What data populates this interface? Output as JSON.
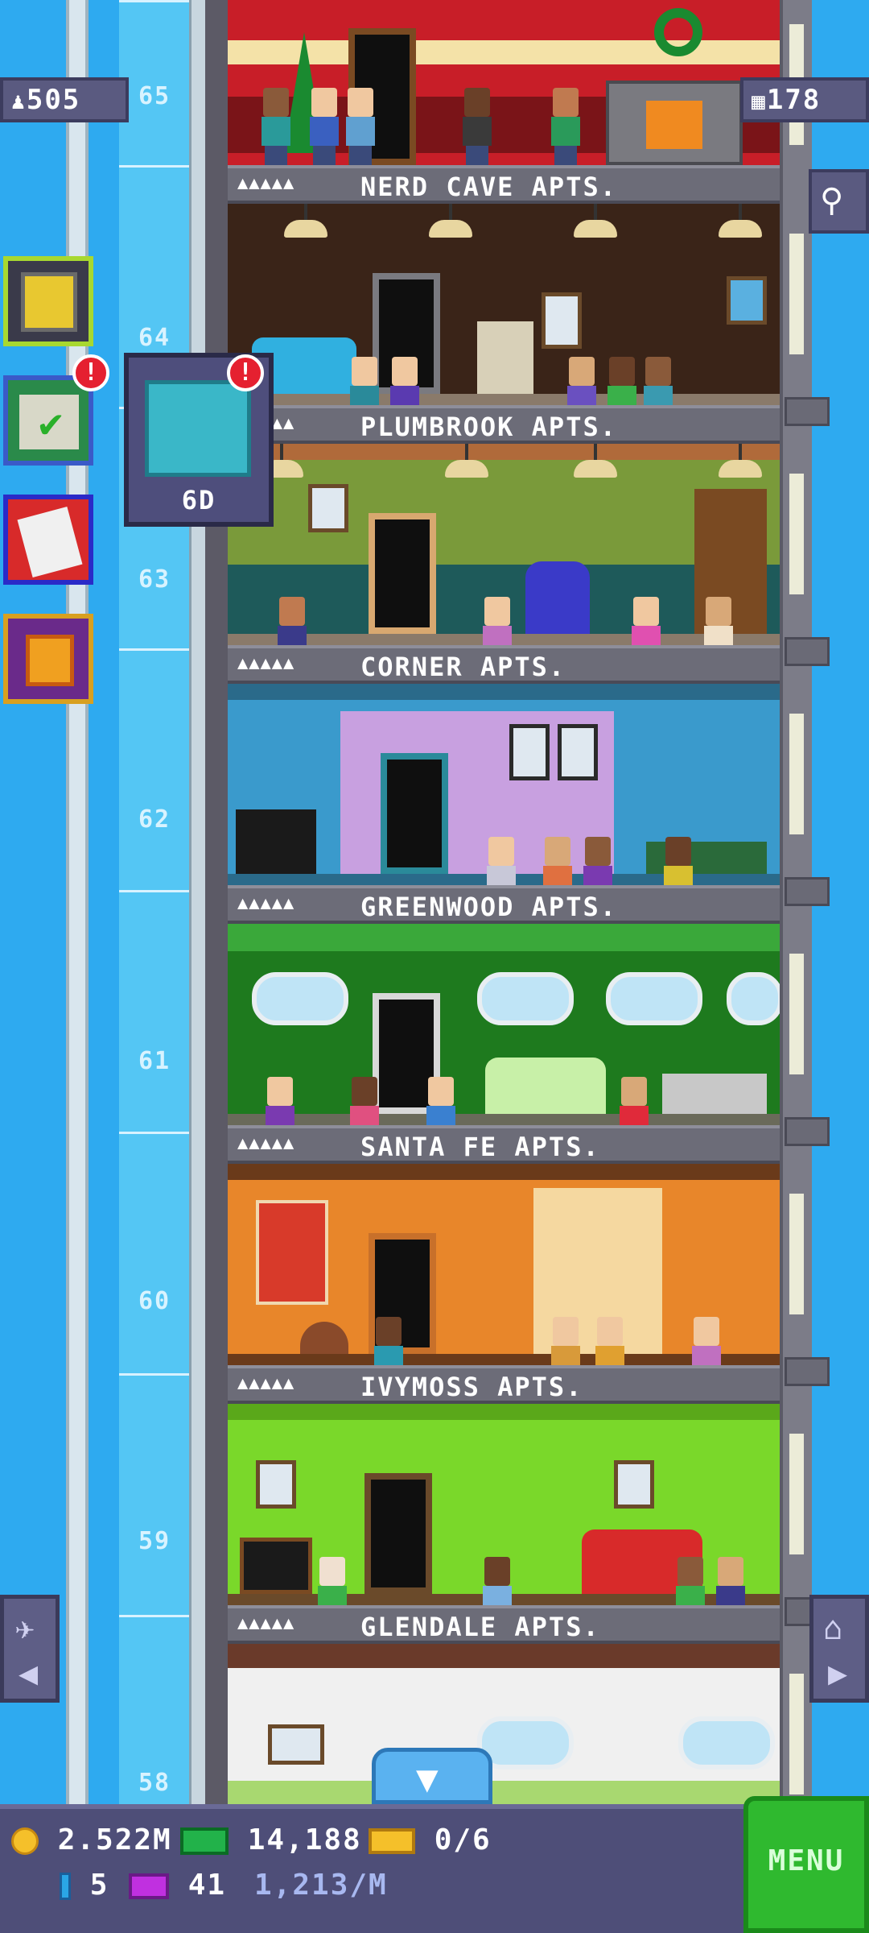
{
  "hud": {
    "population": "505",
    "floors": "178"
  },
  "shaft_floors": [
    "65",
    "64",
    "63",
    "62",
    "61",
    "60",
    "59",
    "58"
  ],
  "tower_floors": [
    {
      "name": "NERD CAVE APTS.",
      "stars": "▲▲▲▲▲"
    },
    {
      "name": "PLUMBROOK APTS.",
      "stars": "▲▲▲▲▲"
    },
    {
      "name": "CORNER APTS.",
      "stars": "▲▲▲▲▲"
    },
    {
      "name": "GREENWOOD APTS.",
      "stars": "▲▲▲▲▲"
    },
    {
      "name": "SANTA FE APTS.",
      "stars": "▲▲▲▲▲"
    },
    {
      "name": "IVYMOSS APTS.",
      "stars": "▲▲▲▲▲"
    },
    {
      "name": "GLENDALE APTS.",
      "stars": "▲▲▲▲▲"
    }
  ],
  "side_buttons": {
    "badge": "!",
    "missions_popup_value": "6D"
  },
  "bottom_bar": {
    "coins": "2.522M",
    "bux": "14,188",
    "tickets": "0/6",
    "keys": "5",
    "vip": "41",
    "income": "1,213/M",
    "menu_label": "MENU"
  },
  "colors": {
    "sky": "#2eaaf0",
    "hud_panel": "#5a5a80",
    "menu_green": "#2fb92f",
    "badge_red": "#e52030"
  }
}
